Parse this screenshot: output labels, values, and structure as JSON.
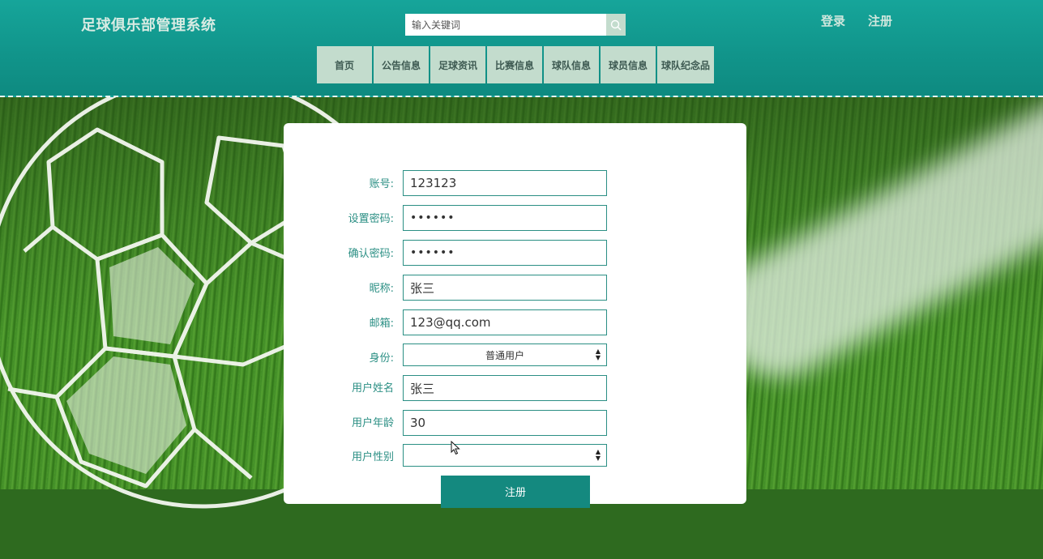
{
  "header": {
    "site_title": "足球俱乐部管理系统",
    "search_placeholder": "输入关键词",
    "login_label": "登录",
    "register_label": "注册"
  },
  "nav": {
    "items": [
      "首页",
      "公告信息",
      "足球资讯",
      "比赛信息",
      "球队信息",
      "球员信息",
      "球队纪念品"
    ]
  },
  "form": {
    "fields": [
      {
        "label": "账号:",
        "value": "123123"
      },
      {
        "label": "设置密码:",
        "value": "••••••"
      },
      {
        "label": "确认密码:",
        "value": "••••••"
      },
      {
        "label": "昵称:",
        "value": "张三"
      },
      {
        "label": "邮箱:",
        "value": "123@qq.com"
      },
      {
        "label": "身份:",
        "value": "普通用户"
      },
      {
        "label": "用户姓名",
        "value": "张三"
      },
      {
        "label": "用户年龄",
        "value": "30"
      },
      {
        "label": "用户性别",
        "value": ""
      }
    ],
    "submit_label": "注册"
  },
  "colors": {
    "header_teal": "#11958b",
    "nav_bg": "#c3dccd",
    "accent": "#2b8f84",
    "button": "#14897f"
  }
}
